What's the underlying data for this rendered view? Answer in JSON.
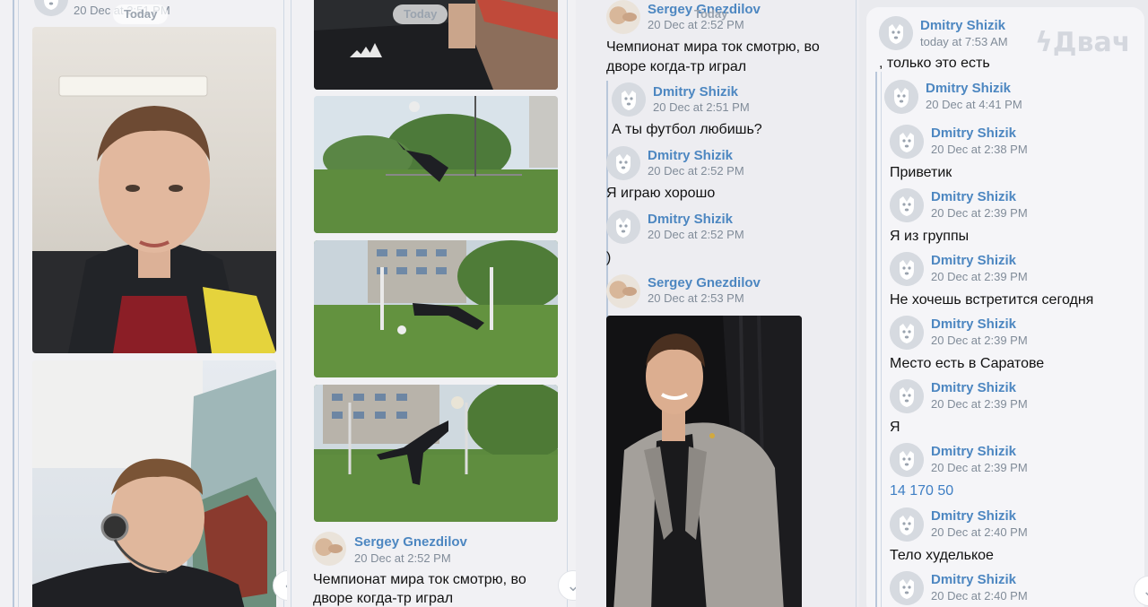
{
  "panel1": {
    "header_time": "20 Dec at 2:51 PM",
    "date_pill": "Today"
  },
  "panel2": {
    "date_pill": "Today",
    "message": {
      "author": "Sergey Gnezdilov",
      "time": "20 Dec at 2:52 PM",
      "text_line1": "Чемпионат мира ток смотрю, во",
      "text_line2": "дворе когда-тр играл"
    }
  },
  "panel3": {
    "top": {
      "author": "Sergey Gnezdilov",
      "time": "20 Dec at 2:52 PM",
      "date_pill": "Today",
      "text_line1": "Чемпионат мира ток смотрю, во",
      "text_line2": "дворе когда-тр играл"
    },
    "messages": [
      {
        "author": "Dmitry Shizik",
        "time": "20 Dec at 2:51 PM",
        "text": "А ты футбол любишь?"
      },
      {
        "author": "Dmitry Shizik",
        "time": "20 Dec at 2:52 PM",
        "text": "Я играю хорошо"
      },
      {
        "author": "Dmitry Shizik",
        "time": "20 Dec at 2:52 PM",
        "text": ")"
      },
      {
        "author": "Sergey Gnezdilov",
        "time": "20 Dec at 2:53 PM",
        "text": ""
      }
    ]
  },
  "panel4": {
    "header": {
      "author": "Dmitry Shizik",
      "time": "today at 7:53 AM",
      "text": ", только это есть"
    },
    "watermark": "Двач",
    "messages": [
      {
        "author": "Dmitry Shizik",
        "time": "20 Dec at 4:41 PM",
        "text": ""
      },
      {
        "author": "Dmitry Shizik",
        "time": "20 Dec at 2:38 PM",
        "text": "Приветик"
      },
      {
        "author": "Dmitry Shizik",
        "time": "20 Dec at 2:39 PM",
        "text": "Я из группы"
      },
      {
        "author": "Dmitry Shizik",
        "time": "20 Dec at 2:39 PM",
        "text": "Не хочешь встретится сегодня"
      },
      {
        "author": "Dmitry Shizik",
        "time": "20 Dec at 2:39 PM",
        "text": "Место есть в Саратове"
      },
      {
        "author": "Dmitry Shizik",
        "time": "20 Dec at 2:39 PM",
        "text": "Я"
      },
      {
        "author": "Dmitry Shizik",
        "time": "20 Dec at 2:39 PM",
        "text": "14 170 50"
      },
      {
        "author": "Dmitry Shizik",
        "time": "20 Dec at 2:40 PM",
        "text": "Тело худелькое"
      },
      {
        "author": "Dmitry Shizik",
        "time": "20 Dec at 2:40 PM",
        "text": ""
      }
    ]
  },
  "icons": {
    "scroll_down": "chevron-down-icon",
    "default_avatar": "dog-avatar-icon"
  },
  "colors": {
    "link": "#4d87c1",
    "time": "#818c99",
    "thread_line": "#b9c7da"
  }
}
